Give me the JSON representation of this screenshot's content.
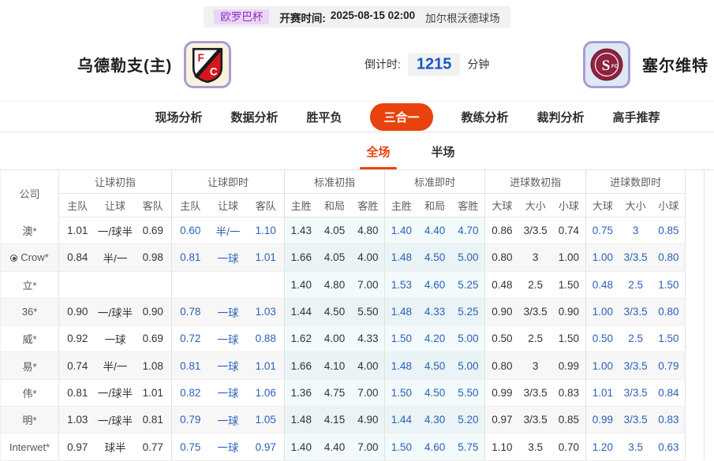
{
  "header_bar": {
    "league": "欧罗巴杯",
    "kickoff_label": "开赛时间:",
    "kickoff_time": "2025-08-15 02:00",
    "venue": "加尔根沃德球场"
  },
  "teams": {
    "home": {
      "name": "乌德勒支(主)"
    },
    "away": {
      "name": "塞尔维特"
    },
    "countdown": {
      "label": "倒计时:",
      "value": "1215",
      "unit": "分钟"
    }
  },
  "nav": {
    "tabs": [
      "现场分析",
      "数据分析",
      "胜平负",
      "三合一",
      "教练分析",
      "裁判分析",
      "高手推荐"
    ],
    "active": "三合一"
  },
  "subtabs": {
    "tabs": [
      "全场",
      "半场"
    ],
    "active": "全场"
  },
  "odds_table": {
    "company_header": "公司",
    "groups": [
      {
        "label": "让球初指",
        "cols": [
          "主队",
          "让球",
          "客队"
        ],
        "live": false,
        "tinted": false
      },
      {
        "label": "让球即时",
        "cols": [
          "主队",
          "让球",
          "客队"
        ],
        "live": true,
        "tinted": false
      },
      {
        "label": "标准初指",
        "cols": [
          "主胜",
          "和局",
          "客胜"
        ],
        "live": false,
        "tinted": true
      },
      {
        "label": "标准即时",
        "cols": [
          "主胜",
          "和局",
          "客胜"
        ],
        "live": true,
        "tinted": true
      },
      {
        "label": "进球数初指",
        "cols": [
          "大球",
          "大小",
          "小球"
        ],
        "live": false,
        "tinted": false
      },
      {
        "label": "进球数即时",
        "cols": [
          "大球",
          "大小",
          "小球"
        ],
        "live": true,
        "tinted": false
      }
    ],
    "rows": [
      {
        "company": "澳*",
        "icon": false,
        "values": [
          "1.01",
          "一/球半",
          "0.69",
          "0.60",
          "半/一",
          "1.10",
          "1.43",
          "4.05",
          "4.80",
          "1.40",
          "4.40",
          "4.70",
          "0.86",
          "3/3.5",
          "0.74",
          "0.75",
          "3",
          "0.85"
        ]
      },
      {
        "company": "Crow*",
        "icon": true,
        "values": [
          "0.84",
          "半/一",
          "0.98",
          "0.81",
          "一球",
          "1.01",
          "1.66",
          "4.05",
          "4.00",
          "1.48",
          "4.50",
          "5.00",
          "0.80",
          "3",
          "1.00",
          "1.00",
          "3/3.5",
          "0.80"
        ]
      },
      {
        "company": "立*",
        "icon": false,
        "values": [
          "",
          "",
          "",
          "",
          "",
          "",
          "1.40",
          "4.80",
          "7.00",
          "1.53",
          "4.60",
          "5.25",
          "0.48",
          "2.5",
          "1.50",
          "0.48",
          "2.5",
          "1.50"
        ]
      },
      {
        "company": "36*",
        "icon": false,
        "values": [
          "0.90",
          "一/球半",
          "0.90",
          "0.78",
          "一球",
          "1.03",
          "1.44",
          "4.50",
          "5.50",
          "1.48",
          "4.33",
          "5.25",
          "0.90",
          "3/3.5",
          "0.90",
          "1.00",
          "3/3.5",
          "0.80"
        ]
      },
      {
        "company": "威*",
        "icon": false,
        "values": [
          "0.92",
          "一球",
          "0.69",
          "0.72",
          "一球",
          "0.88",
          "1.62",
          "4.00",
          "4.33",
          "1.50",
          "4.20",
          "5.00",
          "0.50",
          "2.5",
          "1.50",
          "0.50",
          "2.5",
          "1.50"
        ]
      },
      {
        "company": "易*",
        "icon": false,
        "values": [
          "0.74",
          "半/一",
          "1.08",
          "0.81",
          "一球",
          "1.01",
          "1.66",
          "4.10",
          "4.00",
          "1.48",
          "4.50",
          "5.00",
          "0.80",
          "3",
          "0.99",
          "1.00",
          "3/3.5",
          "0.79"
        ]
      },
      {
        "company": "伟*",
        "icon": false,
        "values": [
          "0.81",
          "一/球半",
          "1.01",
          "0.82",
          "一球",
          "1.06",
          "1.36",
          "4.75",
          "7.00",
          "1.50",
          "4.50",
          "5.50",
          "0.99",
          "3/3.5",
          "0.83",
          "1.01",
          "3/3.5",
          "0.84"
        ]
      },
      {
        "company": "明*",
        "icon": false,
        "values": [
          "1.03",
          "一/球半",
          "0.81",
          "0.79",
          "一球",
          "1.05",
          "1.48",
          "4.15",
          "4.90",
          "1.44",
          "4.30",
          "5.20",
          "0.97",
          "3/3.5",
          "0.85",
          "0.99",
          "3/3.5",
          "0.83"
        ]
      },
      {
        "company": "Interwet*",
        "icon": false,
        "values": [
          "0.97",
          "球半",
          "0.77",
          "0.75",
          "一球",
          "0.97",
          "1.40",
          "4.40",
          "7.00",
          "1.50",
          "4.60",
          "5.75",
          "1.10",
          "3.5",
          "0.70",
          "1.20",
          "3.5",
          "0.63"
        ]
      }
    ]
  },
  "colors": {
    "accent_orange": "#e8430e",
    "live_blue": "#2a62b8",
    "countdown_blue": "#1a56c4",
    "league_purple": "#8a2fc0",
    "standard_tint": "#f2fafb",
    "stripe_gray": "#f7f7f7"
  }
}
